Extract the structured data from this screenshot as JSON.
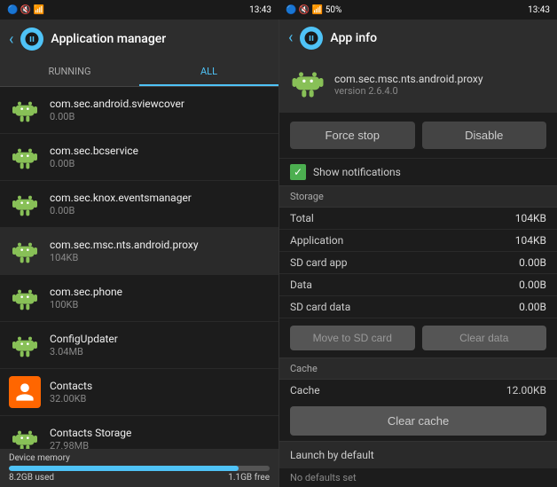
{
  "statusBar": {
    "leftIcons": "🔵 🔇 📶 50%",
    "time": "13:43",
    "rightTime": "13:43"
  },
  "leftPanel": {
    "title": "Application manager",
    "tabs": [
      {
        "label": "RUNNING",
        "active": false
      },
      {
        "label": "ALL",
        "active": true
      }
    ],
    "apps": [
      {
        "name": "com.sec.android.sviewcover",
        "size": "0.00B",
        "icon": "android"
      },
      {
        "name": "com.sec.bcservice",
        "size": "0.00B",
        "icon": "android"
      },
      {
        "name": "com.sec.knox.eventsmanager",
        "size": "0.00B",
        "icon": "android"
      },
      {
        "name": "com.sec.msc.nts.android.proxy",
        "size": "104KB",
        "icon": "android"
      },
      {
        "name": "com.sec.phone",
        "size": "100KB",
        "icon": "android"
      },
      {
        "name": "ConfigUpdater",
        "size": "3.04MB",
        "icon": "android"
      },
      {
        "name": "Contacts",
        "size": "32.00KB",
        "icon": "contacts"
      },
      {
        "name": "Contacts Storage",
        "size": "27.98MB",
        "icon": "android"
      }
    ],
    "footer": {
      "label": "Device memory",
      "used": "8.2GB used",
      "free": "1.1GB free",
      "fillPercent": 88
    }
  },
  "rightPanel": {
    "title": "App info",
    "appName": "com.sec.msc.nts.android.proxy",
    "appVersion": "version 2.6.4.0",
    "buttons": {
      "forceStop": "Force stop",
      "disable": "Disable"
    },
    "showNotifications": "Show notifications",
    "storage": {
      "sectionLabel": "Storage",
      "rows": [
        {
          "label": "Total",
          "value": "104KB"
        },
        {
          "label": "Application",
          "value": "104KB"
        },
        {
          "label": "SD card app",
          "value": "0.00B"
        },
        {
          "label": "Data",
          "value": "0.00B"
        },
        {
          "label": "SD card data",
          "value": "0.00B"
        }
      ],
      "moveToSD": "Move to SD card",
      "clearData": "Clear data"
    },
    "cache": {
      "sectionLabel": "Cache",
      "cacheLabel": "Cache",
      "cacheValue": "12.00KB",
      "clearCache": "Clear cache"
    },
    "launchByDefault": {
      "label": "Launch by default",
      "noDefaults": "No defaults set"
    }
  }
}
